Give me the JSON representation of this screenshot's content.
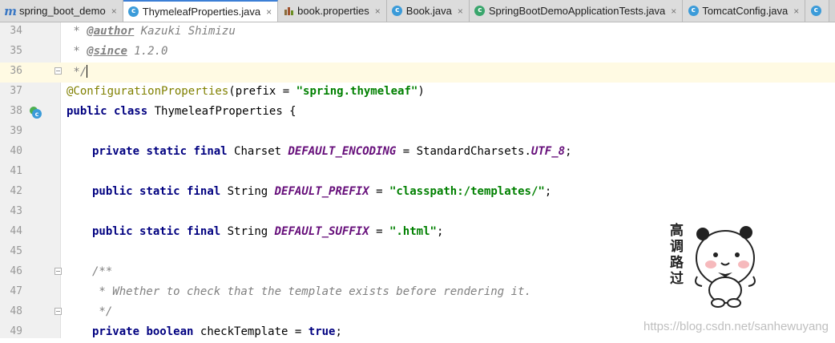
{
  "tabs": [
    {
      "label": "spring_boot_demo",
      "icon": "module-icon",
      "active": false
    },
    {
      "label": "ThymeleafProperties.java",
      "icon": "class-icon",
      "active": true
    },
    {
      "label": "book.properties",
      "icon": "properties-file-icon",
      "active": false
    },
    {
      "label": "Book.java",
      "icon": "class-icon",
      "active": false
    },
    {
      "label": "SpringBootDemoApplicationTests.java",
      "icon": "test-class-icon",
      "active": false
    },
    {
      "label": "TomcatConfig.java",
      "icon": "class-icon",
      "active": false
    }
  ],
  "close_glyph": "×",
  "line_numbers": [
    "34",
    "35",
    "36",
    "37",
    "38",
    "39",
    "40",
    "41",
    "42",
    "43",
    "44",
    "45",
    "46",
    "47",
    "48",
    "49"
  ],
  "code": {
    "l34": {
      "prefix": " * ",
      "tag": "@author",
      "rest": " Kazuki Shimizu"
    },
    "l35": {
      "prefix": " * ",
      "tag": "@since",
      "rest": " 1.2.0"
    },
    "l36": {
      "text": " */"
    },
    "l37": {
      "anno": "@ConfigurationProperties",
      "open": "(prefix = ",
      "str": "\"spring.thymeleaf\"",
      "close": ")"
    },
    "l38": {
      "kw1": "public",
      "kw2": "class",
      "name": " ThymeleafProperties {"
    },
    "l40": {
      "kw1": "private",
      "kw2": "static",
      "kw3": "final",
      "type": " Charset ",
      "field": "DEFAULT_ENCODING",
      "mid": " = StandardCharsets.",
      "field2": "UTF_8",
      "end": ";"
    },
    "l42": {
      "kw1": "public",
      "kw2": "static",
      "kw3": "final",
      "type": " String ",
      "field": "DEFAULT_PREFIX",
      "mid": " = ",
      "str": "\"classpath:/templates/\"",
      "end": ";"
    },
    "l44": {
      "kw1": "public",
      "kw2": "static",
      "kw3": "final",
      "type": " String ",
      "field": "DEFAULT_SUFFIX",
      "mid": " = ",
      "str": "\".html\"",
      "end": ";"
    },
    "l46": {
      "text": "/**"
    },
    "l47": {
      "text": " * Whether to check that the template exists before rendering it."
    },
    "l48": {
      "text": " */"
    },
    "l49": {
      "kw1": "private",
      "kw2": "boolean",
      "name": " checkTemplate = ",
      "kw3": "true",
      "end": ";"
    }
  },
  "sticker_text": "高调路过",
  "watermark": "https://blog.csdn.net/sanhewuyang",
  "colors": {
    "keyword": "#000080",
    "string": "#008000",
    "comment": "#808080",
    "field": "#660e7a",
    "annotation": "#808000",
    "current_line": "#fffae3"
  }
}
